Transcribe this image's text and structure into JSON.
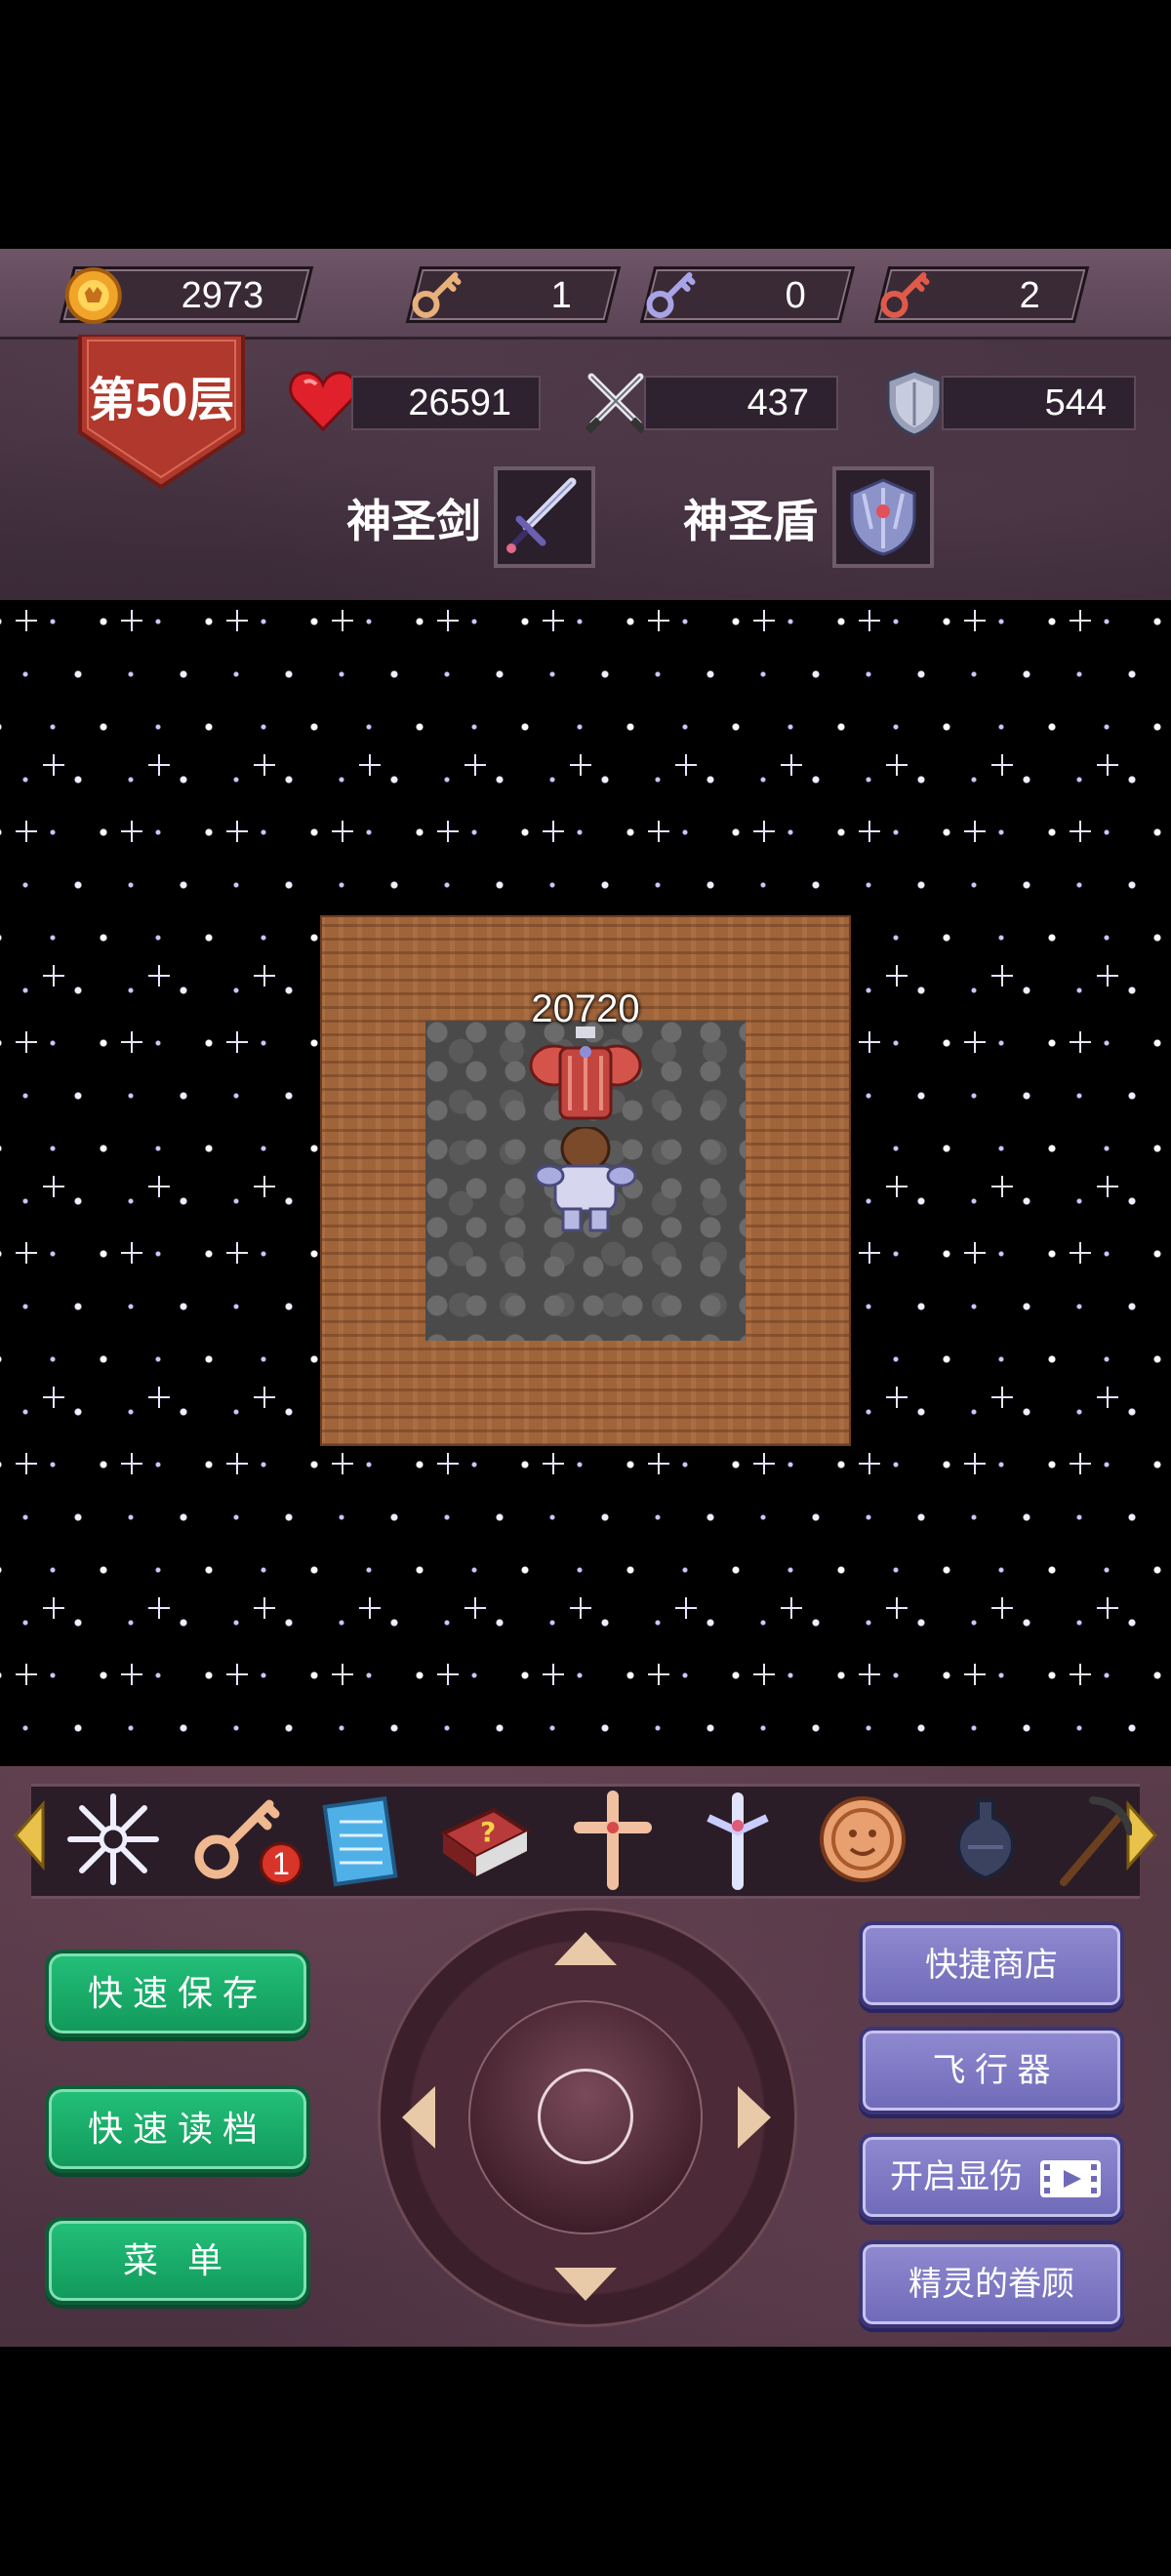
{
  "resources": {
    "gold": "2973",
    "yellow_keys": "1",
    "blue_keys": "0",
    "red_keys": "2"
  },
  "floor": {
    "label": "第50层"
  },
  "stats": {
    "hp": "26591",
    "attack": "437",
    "defense": "544"
  },
  "equipment": {
    "weapon_label": "神圣剑",
    "shield_label": "神圣盾"
  },
  "map": {
    "enemy_hp_label": "20720"
  },
  "item_bar": {
    "items": [
      "snowflake-icon",
      "key-icon",
      "notepad-icon",
      "monster-book-icon",
      "cross-icon",
      "holy-sword-icon",
      "coin-icon",
      "vase-icon",
      "pickaxe-icon"
    ],
    "key_badge": "1"
  },
  "buttons": {
    "quick_save": "快速保存",
    "quick_load": "快速读档",
    "menu": "菜 单",
    "quick_shop": "快捷商店",
    "flyer": "飞 行 器",
    "show_damage": "开启显伤",
    "fairy_favor": "精灵的眷顾"
  },
  "colors": {
    "hud_bg": "#3b2a38",
    "green_button": "#11985a",
    "purple_button": "#6f6ab8",
    "floor_badge": "#b0382c"
  }
}
